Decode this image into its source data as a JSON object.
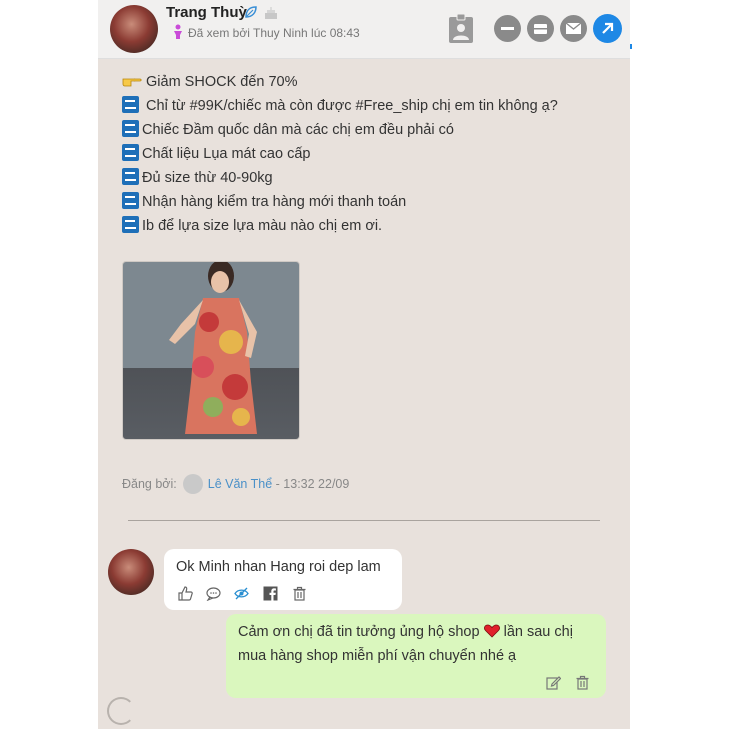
{
  "header": {
    "name": "Trang Thuỳ",
    "seen_text": "Đã xem bởi Thuy Ninh lúc 08:43",
    "icons": [
      "leaf-icon",
      "cake-icon",
      "contact-card-icon",
      "minus-icon",
      "inbox-icon",
      "mail-icon",
      "share-icon"
    ]
  },
  "post": {
    "lines": [
      "Giảm SHOCK đến 70%",
      "Chỉ từ #99K/chiếc mà còn được #Free_ship chị em tin không ạ?",
      "Chiếc Đầm quốc dân mà các chị em đều phải có",
      "Chất liệu Lụa mát cao cấp",
      "Đủ size thừ 40-90kg",
      "Nhận hàng kiểm tra hàng mới thanh toán",
      "Ib để lựa size lựa màu nào chị em ơi."
    ],
    "posted_label": "Đăng bởi:",
    "author": "Lê Văn Thể",
    "time": "- 13:32 22/09"
  },
  "comment": {
    "text": "Ok Minh nhan Hang roi dep lam",
    "actions": [
      "like-icon",
      "reply-icon",
      "hide-icon",
      "facebook-icon",
      "trash-icon"
    ]
  },
  "reply": {
    "text_part1": "Cảm ơn chị đã tin tưởng ủng hộ shop",
    "text_part2": " lần sau chị mua hàng shop miễn phí vận chuyển nhé ạ",
    "actions": [
      "edit-icon",
      "trash-icon"
    ]
  },
  "colors": {
    "panel_bg": "#e8e1dc",
    "header_bg": "#f1f0ef",
    "reply_bg": "#daf7be",
    "accent_blue": "#1e88e5",
    "link": "#4a90c8"
  }
}
